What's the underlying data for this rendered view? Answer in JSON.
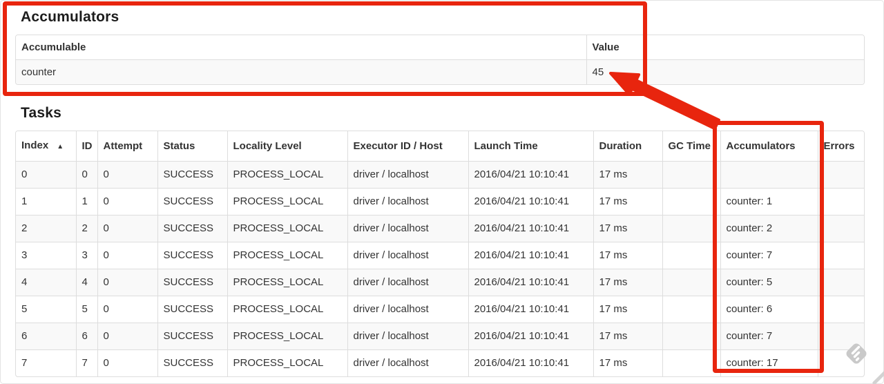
{
  "accumulators_section": {
    "title": "Accumulators",
    "table": {
      "headers": {
        "accumulable": "Accumulable",
        "value": "Value"
      },
      "rows": [
        {
          "accumulable": "counter",
          "value": "45"
        }
      ]
    }
  },
  "tasks_section": {
    "title": "Tasks",
    "table": {
      "columns": [
        "Index",
        "ID",
        "Attempt",
        "Status",
        "Locality Level",
        "Executor ID / Host",
        "Launch Time",
        "Duration",
        "GC Time",
        "Accumulators",
        "Errors"
      ],
      "sort_icon": "▲",
      "sorted_column": "Index",
      "rows": [
        {
          "index": "0",
          "id": "0",
          "attempt": "0",
          "status": "SUCCESS",
          "locality_level": "PROCESS_LOCAL",
          "executor_id_host": "driver / localhost",
          "launch_time": "2016/04/21 10:10:41",
          "duration": "17 ms",
          "gc_time": "",
          "accumulators": "",
          "errors": ""
        },
        {
          "index": "1",
          "id": "1",
          "attempt": "0",
          "status": "SUCCESS",
          "locality_level": "PROCESS_LOCAL",
          "executor_id_host": "driver / localhost",
          "launch_time": "2016/04/21 10:10:41",
          "duration": "17 ms",
          "gc_time": "",
          "accumulators": "counter: 1",
          "errors": ""
        },
        {
          "index": "2",
          "id": "2",
          "attempt": "0",
          "status": "SUCCESS",
          "locality_level": "PROCESS_LOCAL",
          "executor_id_host": "driver / localhost",
          "launch_time": "2016/04/21 10:10:41",
          "duration": "17 ms",
          "gc_time": "",
          "accumulators": "counter: 2",
          "errors": ""
        },
        {
          "index": "3",
          "id": "3",
          "attempt": "0",
          "status": "SUCCESS",
          "locality_level": "PROCESS_LOCAL",
          "executor_id_host": "driver / localhost",
          "launch_time": "2016/04/21 10:10:41",
          "duration": "17 ms",
          "gc_time": "",
          "accumulators": "counter: 7",
          "errors": ""
        },
        {
          "index": "4",
          "id": "4",
          "attempt": "0",
          "status": "SUCCESS",
          "locality_level": "PROCESS_LOCAL",
          "executor_id_host": "driver / localhost",
          "launch_time": "2016/04/21 10:10:41",
          "duration": "17 ms",
          "gc_time": "",
          "accumulators": "counter: 5",
          "errors": ""
        },
        {
          "index": "5",
          "id": "5",
          "attempt": "0",
          "status": "SUCCESS",
          "locality_level": "PROCESS_LOCAL",
          "executor_id_host": "driver / localhost",
          "launch_time": "2016/04/21 10:10:41",
          "duration": "17 ms",
          "gc_time": "",
          "accumulators": "counter: 6",
          "errors": ""
        },
        {
          "index": "6",
          "id": "6",
          "attempt": "0",
          "status": "SUCCESS",
          "locality_level": "PROCESS_LOCAL",
          "executor_id_host": "driver / localhost",
          "launch_time": "2016/04/21 10:10:41",
          "duration": "17 ms",
          "gc_time": "",
          "accumulators": "counter: 7",
          "errors": ""
        },
        {
          "index": "7",
          "id": "7",
          "attempt": "0",
          "status": "SUCCESS",
          "locality_level": "PROCESS_LOCAL",
          "executor_id_host": "driver / localhost",
          "launch_time": "2016/04/21 10:10:41",
          "duration": "17 ms",
          "gc_time": "",
          "accumulators": "counter: 17",
          "errors": ""
        }
      ]
    }
  },
  "annotations": {
    "highlight_color": "#e8250e",
    "top_rectangle_target": "accumulators-summary-table",
    "column_rectangle_target": "tasks-accumulators-column",
    "arrow_target": "accumulator-total-value-45"
  },
  "watermark": {
    "name": "skitch-watermark",
    "color": "#c9c9c9"
  }
}
